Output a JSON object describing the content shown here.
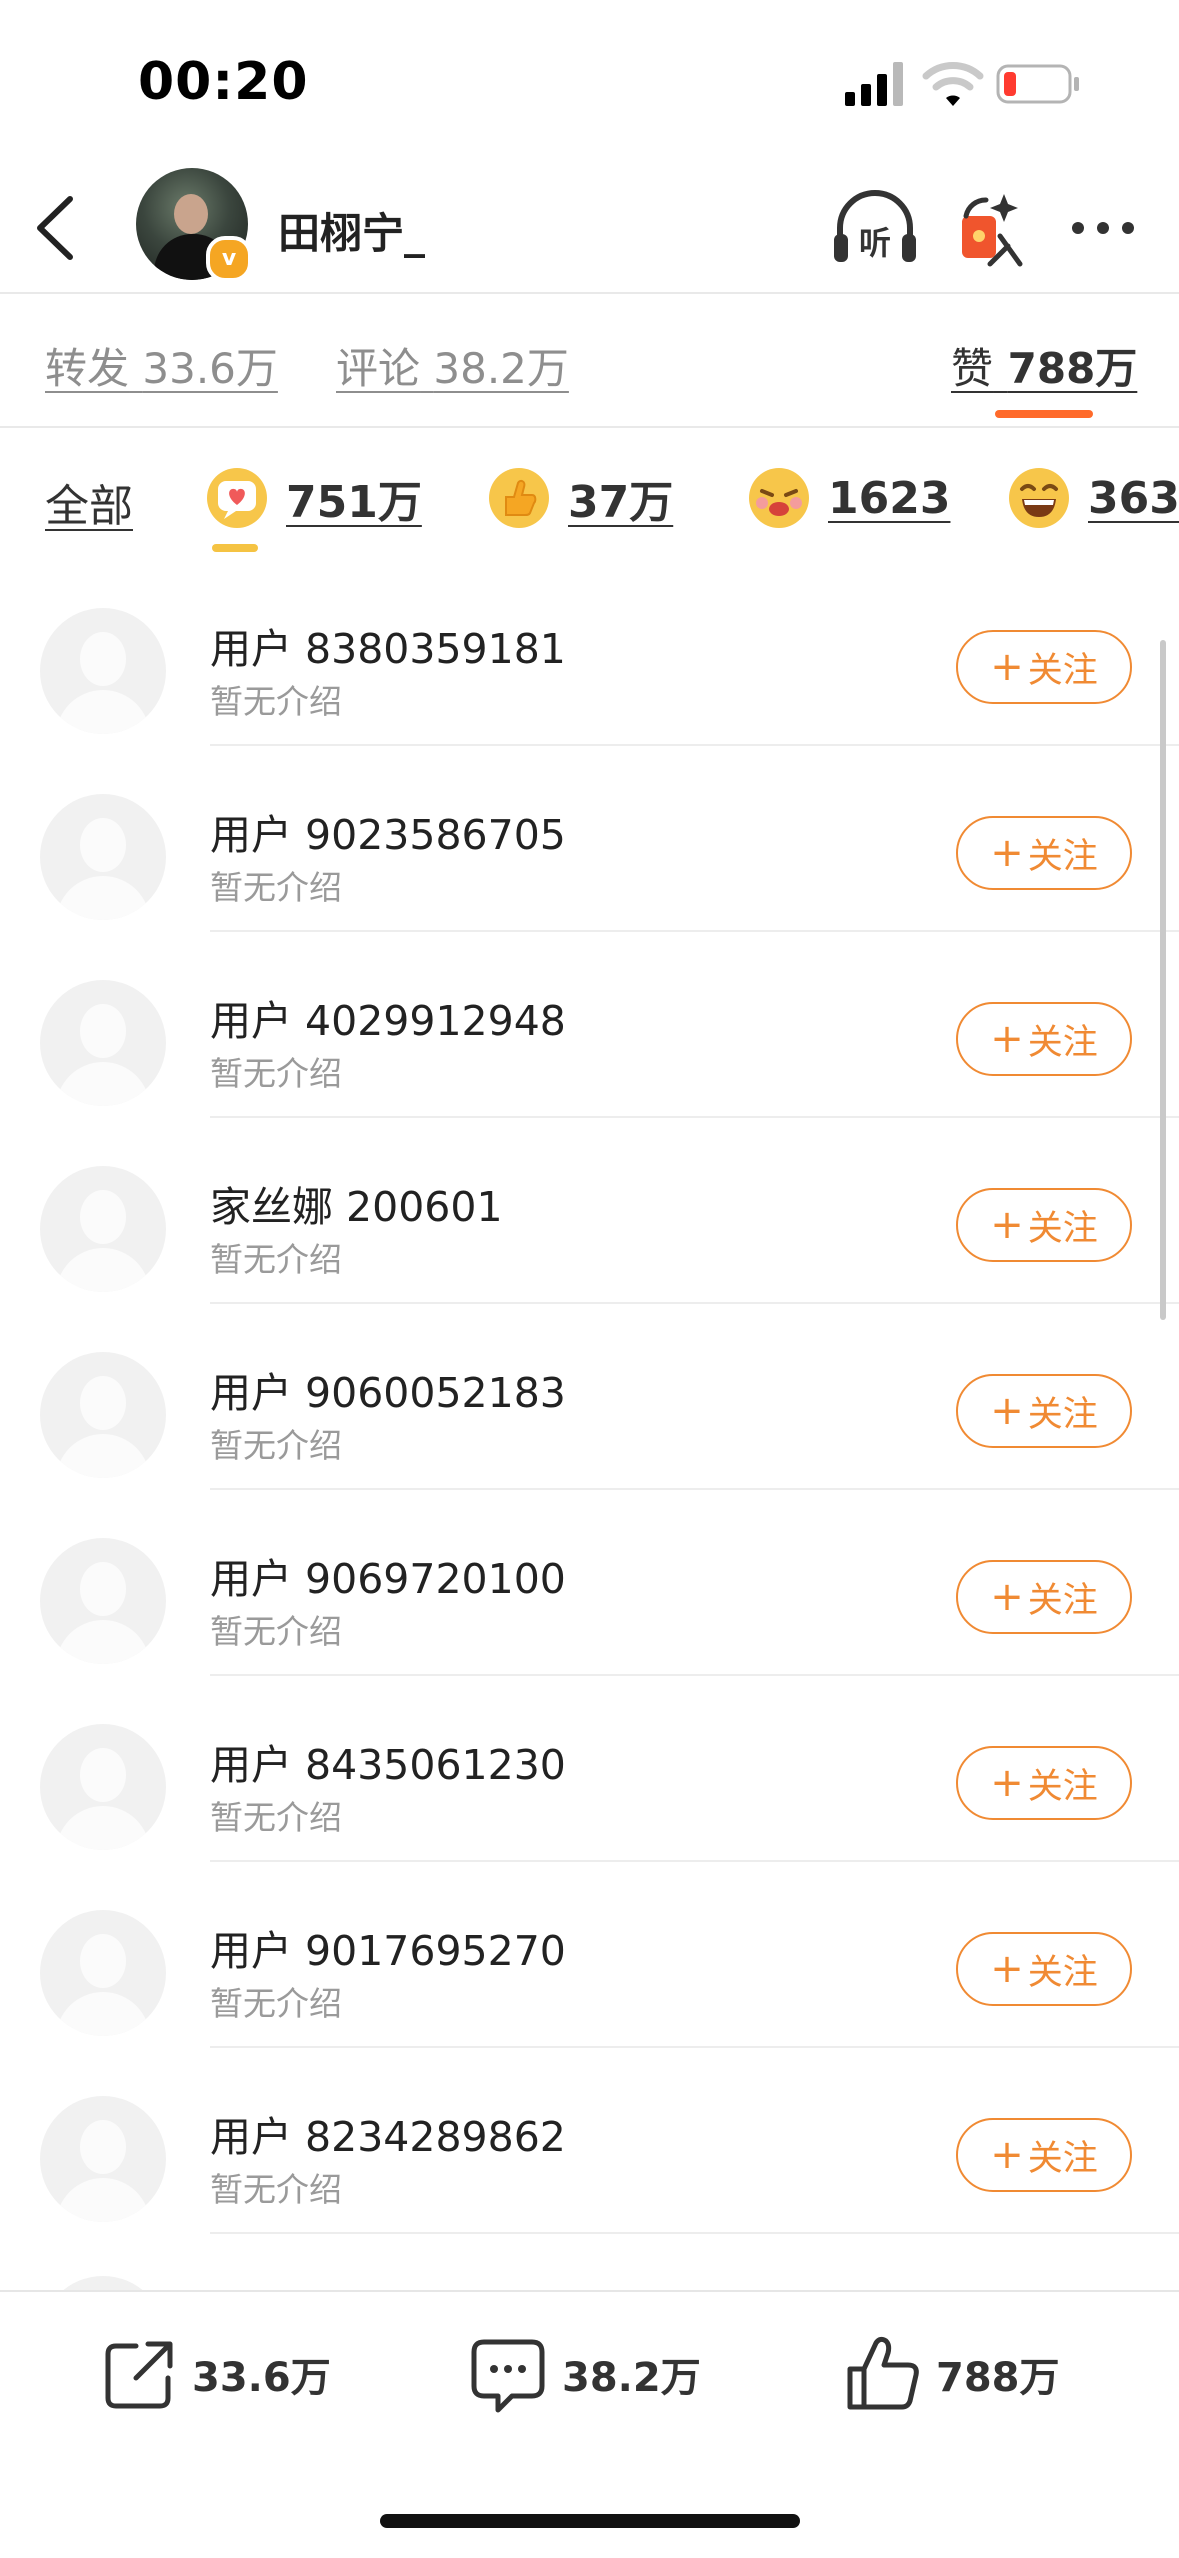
{
  "status_bar": {
    "time": "00:20",
    "icons": [
      "signal-icon",
      "wifi-icon",
      "battery-icon"
    ],
    "battery_color": "#ff3b30"
  },
  "header": {
    "username": "田栩宁_",
    "verified_badge": "v",
    "icons": [
      "back-icon",
      "listen-icon",
      "gift-icon",
      "more-icon"
    ],
    "listen_label": "听"
  },
  "tabs": [
    {
      "label": "转发",
      "count": "33.6万"
    },
    {
      "label": "评论",
      "count": "38.2万"
    },
    {
      "label": "赞",
      "count": "788万",
      "active": true
    }
  ],
  "reactions": {
    "all_label": "全部",
    "items": [
      {
        "icon": "heart-bubble-icon",
        "count": "751万",
        "active": true
      },
      {
        "icon": "thumbs-up-emoji-icon",
        "count": "37万"
      },
      {
        "icon": "tearful-emoji-icon",
        "count": "1623"
      },
      {
        "icon": "laughing-emoji-icon",
        "count": "363"
      }
    ]
  },
  "users": [
    {
      "name": "用户 8380359181",
      "bio": "暂无介绍",
      "follow": "关注"
    },
    {
      "name": "用户 9023586705",
      "bio": "暂无介绍",
      "follow": "关注"
    },
    {
      "name": "用户 4029912948",
      "bio": "暂无介绍",
      "follow": "关注"
    },
    {
      "name": "家丝娜 200601",
      "bio": "暂无介绍",
      "follow": "关注"
    },
    {
      "name": "用户 9060052183",
      "bio": "暂无介绍",
      "follow": "关注"
    },
    {
      "name": "用户 9069720100",
      "bio": "暂无介绍",
      "follow": "关注"
    },
    {
      "name": "用户 8435061230",
      "bio": "暂无介绍",
      "follow": "关注"
    },
    {
      "name": "用户 9017695270",
      "bio": "暂无介绍",
      "follow": "关注"
    },
    {
      "name": "用户 8234289862",
      "bio": "暂无介绍",
      "follow": "关注"
    }
  ],
  "bottom_bar": {
    "repost_count": "33.6万",
    "comment_count": "38.2万",
    "like_count": "788万"
  },
  "colors": {
    "accent": "#ff6a2a",
    "follow": "#f08a33",
    "reaction_indicator": "#f5c343"
  }
}
